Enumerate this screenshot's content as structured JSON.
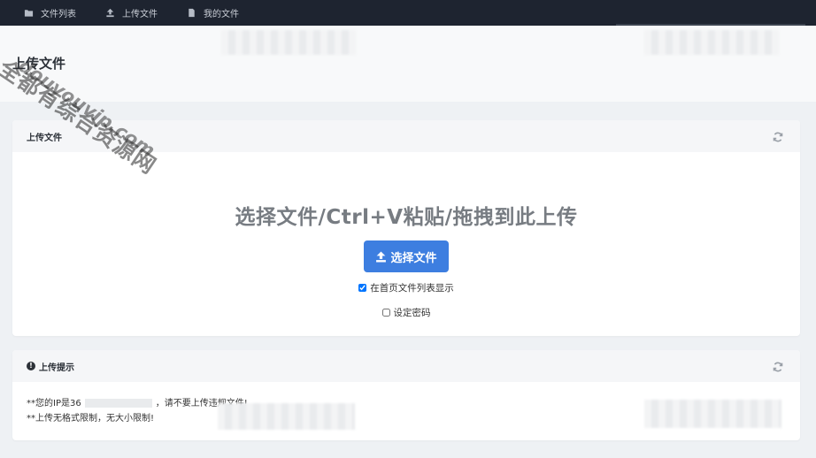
{
  "nav": {
    "items": [
      {
        "label": "文件列表",
        "icon": "folder-icon"
      },
      {
        "label": "上传文件",
        "icon": "upload-icon"
      },
      {
        "label": "我的文件",
        "icon": "file-icon"
      }
    ]
  },
  "header": {
    "title": "上传文件"
  },
  "upload_card": {
    "title": "上传文件",
    "drop_text": "选择文件/Ctrl+V粘贴/拖拽到此上传",
    "choose_button_label": "选择文件",
    "show_on_homepage_label": "在首页文件列表显示",
    "show_on_homepage_checked": true,
    "set_password_label": "设定密码",
    "set_password_checked": false
  },
  "tips_card": {
    "title": "上传提示",
    "line1_prefix": "**您的IP是36",
    "line1_suffix": "，请不要上传违规文件!",
    "line2": "**上传无格式限制，无大小限制!"
  },
  "watermark": {
    "line1": "全都有综合资源网",
    "line2": "douyouvip.com"
  },
  "colors": {
    "navbar": "#1e2430",
    "primary_button": "#3d7ee0",
    "page_background": "#eef1f4"
  }
}
